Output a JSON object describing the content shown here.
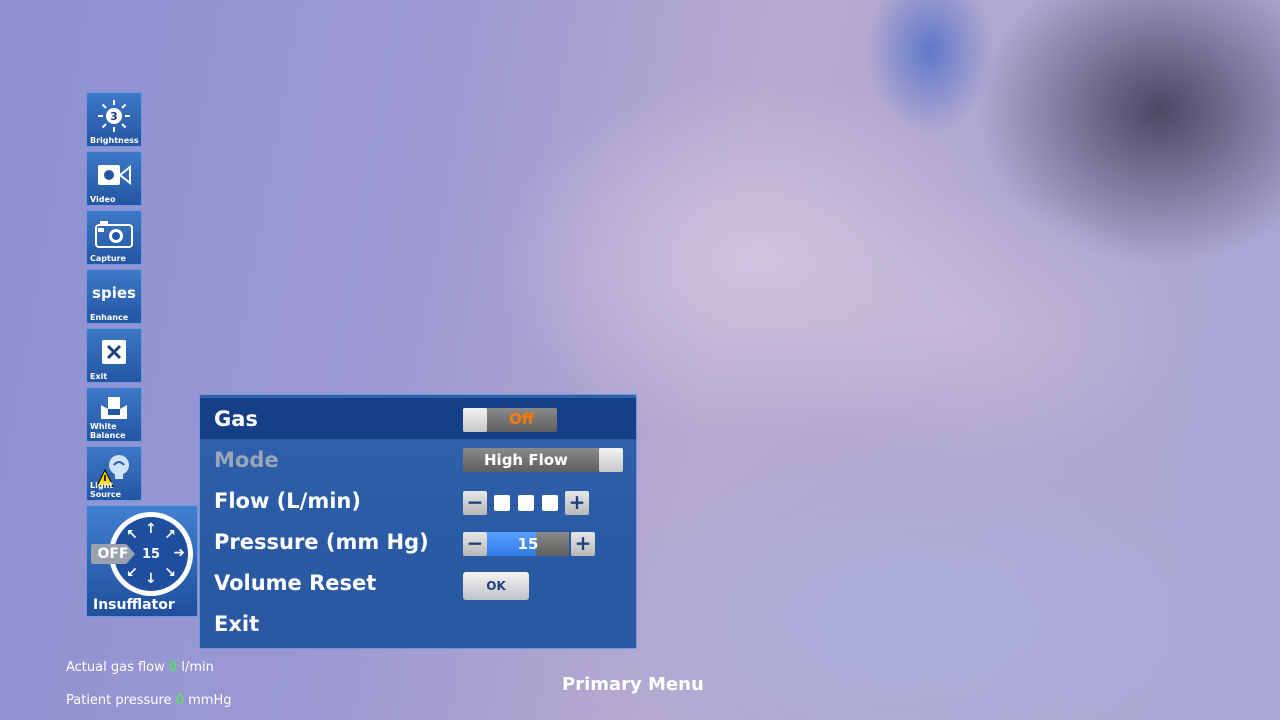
{
  "toolbar": {
    "brightness": {
      "label": "Brightness",
      "level": "3"
    },
    "video": {
      "label": "Video"
    },
    "capture": {
      "label": "Capture"
    },
    "enhance": {
      "label": "Enhance",
      "logo": "spies"
    },
    "exit": {
      "label": "Exit"
    },
    "white_balance": {
      "label": "White Balance"
    },
    "light_source": {
      "label": "Light Source"
    },
    "insufflator": {
      "label": "Insufflator",
      "state": "OFF",
      "value": "15"
    }
  },
  "menu": {
    "gas": {
      "label": "Gas",
      "value": "Off"
    },
    "mode": {
      "label": "Mode",
      "value": "High Flow"
    },
    "flow": {
      "label": "Flow (L/min)",
      "level_squares": 3
    },
    "pressure": {
      "label": "Pressure (mm Hg)",
      "value": "15",
      "fill_fraction": 0.6
    },
    "volume_reset": {
      "label": "Volume Reset",
      "button": "OK"
    },
    "exit": {
      "label": "Exit"
    }
  },
  "status": {
    "gas_flow_label": "Actual gas flow",
    "gas_flow_value": "0",
    "gas_flow_unit": "l/min",
    "pressure_label": "Patient pressure",
    "pressure_value": "0",
    "pressure_unit": "mmHg"
  },
  "footer": {
    "title": "Primary Menu"
  },
  "colors": {
    "accent": "#2f62ad",
    "selected_row": "#153f86",
    "gas_off": "#ff7a00",
    "status_value": "#3bff3b"
  }
}
